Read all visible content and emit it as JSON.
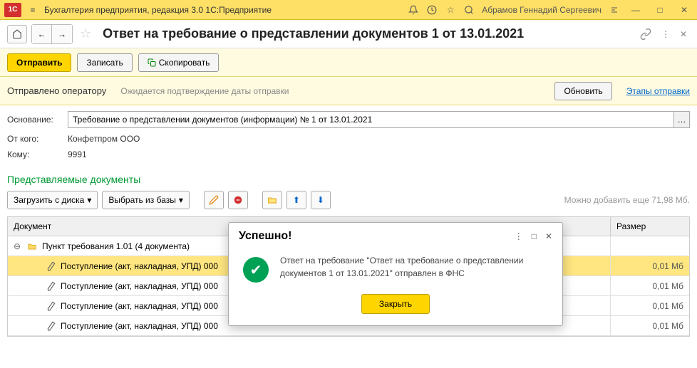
{
  "titlebar": {
    "app": "Бухгалтерия предприятия, редакция 3.0 1С:Предприятие",
    "user": "Абрамов Геннадий Сергеевич"
  },
  "doc": {
    "title": "Ответ на требование о представлении документов 1 от 13.01.2021"
  },
  "actions": {
    "send": "Отправить",
    "save": "Записать",
    "copy": "Скопировать"
  },
  "status": {
    "sent": "Отправлено оператору",
    "waiting": "Ожидается подтверждение даты отправки",
    "refresh": "Обновить",
    "stages": "Этапы отправки"
  },
  "form": {
    "basis_label": "Основание:",
    "basis_value": "Требование о представлении документов (информации) № 1 от 13.01.2021",
    "from_label": "От кого:",
    "from_value": "Конфетпром ООО",
    "to_label": "Кому:",
    "to_value": "9991"
  },
  "section": {
    "title": "Представляемые документы"
  },
  "doctoolbar": {
    "load": "Загрузить с диска",
    "select": "Выбрать из базы",
    "hint": "Можно добавить еще 71,98 Мб."
  },
  "grid": {
    "col_doc": "Документ",
    "col_size": "Размер",
    "group": "Пункт требования 1.01 (4 документа)",
    "rows": [
      {
        "name": "Поступление (акт, накладная, УПД) 000",
        "size": "0,01 Мб",
        "sel": true
      },
      {
        "name": "Поступление (акт, накладная, УПД) 000",
        "size": "0,01 Мб",
        "sel": false
      },
      {
        "name": "Поступление (акт, накладная, УПД) 000",
        "size": "0,01 Мб",
        "sel": false
      },
      {
        "name": "Поступление (акт, накладная, УПД) 000",
        "size": "0,01 Мб",
        "sel": false
      }
    ]
  },
  "modal": {
    "title": "Успешно!",
    "text": "Ответ на требование \"Ответ на требование о представлении документов 1 от 13.01.2021\" отправлен в ФНС",
    "close": "Закрыть"
  }
}
